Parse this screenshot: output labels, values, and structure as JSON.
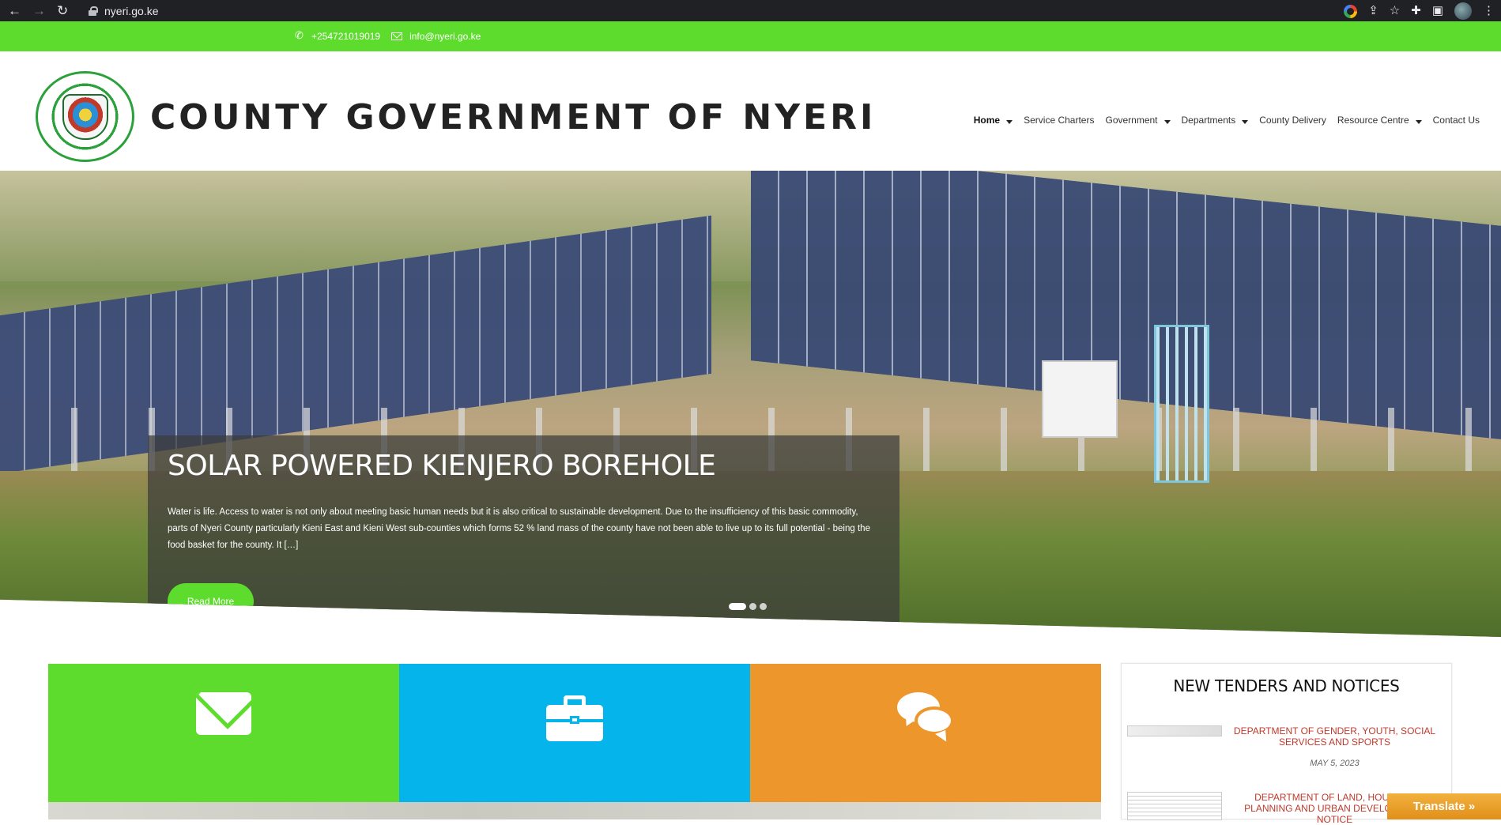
{
  "browser": {
    "url": "nyeri.go.ke"
  },
  "topbar": {
    "phone": "+254721019019",
    "email": "info@nyeri.go.ke"
  },
  "header": {
    "logo_text": "COUNTY GOVERNMENT OF NYERI",
    "site_title": "COUNTY GOVERNMENT OF NYERI"
  },
  "nav": {
    "home": "Home",
    "service_charters": "Service Charters",
    "government": "Government",
    "departments": "Departments",
    "county_delivery": "County Delivery",
    "resource_centre": "Resource Centre",
    "contact_us": "Contact Us"
  },
  "hero": {
    "title": "SOLAR POWERED KIENJERO BOREHOLE",
    "excerpt": "Water is life. Access to water is not only about meeting basic human needs but it is also critical to sustainable development. Due to the insufficiency of this basic commodity, parts of Nyeri County particularly Kieni East and Kieni West sub-counties which forms 52 % land mass of the county have not been able to live up to its full potential - being the food basket for the county. It […]",
    "button": "Read More"
  },
  "tenders": {
    "heading": "NEW TENDERS AND NOTICES",
    "items": [
      {
        "title": "DEPARTMENT OF GENDER, YOUTH, SOCIAL SERVICES AND SPORTS",
        "date": "MAY 5, 2023"
      },
      {
        "title": "DEPARTMENT OF LAND, HOUSING, PLANNING AND URBAN DEVELOPMENT NOTICE"
      }
    ]
  },
  "translate": "Translate »",
  "colors": {
    "brand_green": "#5edc2e",
    "tile_blue": "#06b4ec",
    "tile_orange": "#ec962c",
    "notice_red": "#c0392b"
  }
}
